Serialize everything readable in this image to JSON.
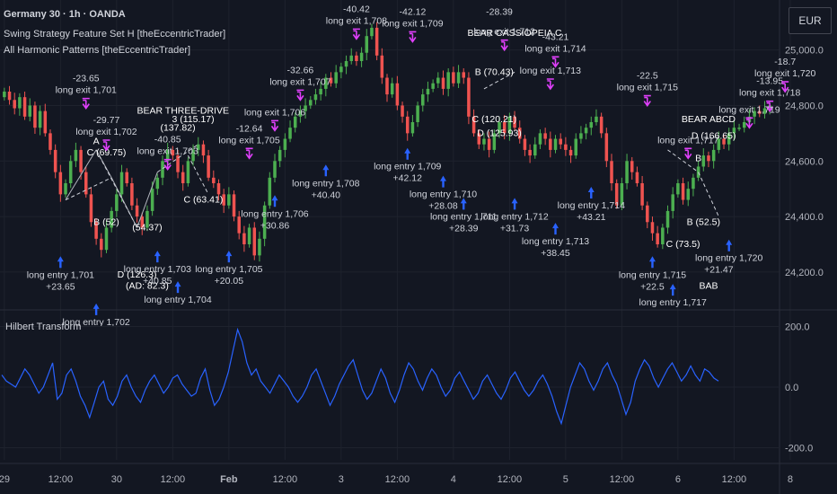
{
  "header": {
    "symbol": "Germany 30 · 1h · OANDA",
    "indicator1": "Swing Strategy Feature Set H [theEccentricTrader]",
    "indicator2": "All Harmonic Patterns [theEccentricTrader]"
  },
  "currency_button": "EUR",
  "oscillator": {
    "title": "Hilbert Transform"
  },
  "colors": {
    "background": "#131722",
    "grid": "#1e222d",
    "bull_candle": "#4caf50",
    "bear_candle": "#ef5350",
    "entry_arrow": "#2962ff",
    "exit_arrow": "#e040fb",
    "hilbert_line": "#2962ff",
    "text": "#d1d4dc",
    "axis_text": "#b2b5be"
  },
  "chart_data": [
    {
      "type": "candlestick",
      "ylim": [
        24080,
        25180
      ],
      "price_ticks": [
        24200,
        24400,
        24600,
        24800,
        25000
      ],
      "price_tick_labels": [
        "24,200.0",
        "24,400.0",
        "24,600.0",
        "24,800.0",
        "25,000.0"
      ],
      "time_ticks": [
        {
          "index": 0,
          "label": "29"
        },
        {
          "index": 11,
          "label": "12:00"
        },
        {
          "index": 22,
          "label": "30"
        },
        {
          "index": 33,
          "label": "12:00"
        },
        {
          "index": 44,
          "label": "Feb",
          "bold": true
        },
        {
          "index": 55,
          "label": "12:00"
        },
        {
          "index": 66,
          "label": "3"
        },
        {
          "index": 77,
          "label": "12:00"
        },
        {
          "index": 88,
          "label": "4"
        },
        {
          "index": 99,
          "label": "12:00"
        },
        {
          "index": 110,
          "label": "5"
        },
        {
          "index": 121,
          "label": "12:00"
        },
        {
          "index": 132,
          "label": "6"
        },
        {
          "index": 143,
          "label": "12:00"
        },
        {
          "index": 154,
          "label": "8"
        }
      ],
      "closes": [
        24850,
        24820,
        24790,
        24830,
        24760,
        24800,
        24720,
        24780,
        24700,
        24640,
        24560,
        24480,
        24520,
        24600,
        24640,
        24560,
        24480,
        24380,
        24320,
        24280,
        24360,
        24420,
        24480,
        24560,
        24520,
        24440,
        24400,
        24360,
        24420,
        24500,
        24540,
        24600,
        24640,
        24620,
        24560,
        24520,
        24600,
        24640,
        24660,
        24620,
        24540,
        24520,
        24480,
        24440,
        24480,
        24400,
        24340,
        24300,
        24360,
        24260,
        24320,
        24440,
        24540,
        24600,
        24640,
        24680,
        24720,
        24760,
        24780,
        24800,
        24820,
        24840,
        24860,
        24900,
        24880,
        24920,
        24940,
        24960,
        24980,
        24960,
        24990,
        25050,
        25080,
        24980,
        24900,
        24840,
        24880,
        24800,
        24760,
        24700,
        24740,
        24800,
        24840,
        24860,
        24880,
        24900,
        24860,
        24920,
        24880,
        24920,
        24900,
        24760,
        24700,
        24660,
        24680,
        24640,
        24700,
        24740,
        24700,
        24760,
        24720,
        24680,
        24640,
        24620,
        24660,
        24700,
        24680,
        24640,
        24680,
        24660,
        24640,
        24620,
        24680,
        24700,
        24720,
        24740,
        24760,
        24700,
        24600,
        24520,
        24440,
        24520,
        24600,
        24560,
        24520,
        24440,
        24380,
        24340,
        24300,
        24360,
        24420,
        24480,
        24520,
        24460,
        24500,
        24540,
        24580,
        24620,
        24600,
        24640,
        24680,
        24660,
        24700,
        24720,
        24720,
        24740,
        24760,
        24780,
        24770,
        24790,
        24800
      ],
      "series_hilbert": [
        40,
        20,
        10,
        0,
        30,
        60,
        40,
        10,
        -20,
        0,
        40,
        80,
        -40,
        -20,
        40,
        60,
        20,
        -30,
        -60,
        -100,
        -50,
        0,
        20,
        -40,
        -60,
        -30,
        20,
        40,
        0,
        -30,
        -50,
        -10,
        20,
        40,
        10,
        -20,
        0,
        30,
        40,
        10,
        -10,
        -30,
        -20,
        30,
        60,
        -10,
        -60,
        -40,
        0,
        50,
        120,
        190,
        150,
        80,
        40,
        60,
        20,
        0,
        -20,
        10,
        40,
        20,
        0,
        -30,
        -50,
        -30,
        0,
        40,
        60,
        20,
        -20,
        -60,
        -30,
        10,
        40,
        70,
        90,
        40,
        -10,
        -40,
        -20,
        20,
        60,
        30,
        -20,
        -50,
        -10,
        40,
        80,
        60,
        20,
        -10,
        30,
        60,
        40,
        0,
        -30,
        -10,
        30,
        50,
        20,
        -10,
        -40,
        -20,
        20,
        40,
        10,
        -20,
        -40,
        -10,
        30,
        50,
        20,
        -10,
        -30,
        -10,
        20,
        40,
        10,
        -30,
        -80,
        -120,
        -60,
        0,
        40,
        80,
        60,
        20,
        -10,
        20,
        60,
        80,
        40,
        10,
        -40,
        -90,
        -50,
        20,
        60,
        90,
        70,
        30,
        0,
        30,
        60,
        80,
        50,
        20,
        40,
        70,
        40,
        20,
        60,
        50,
        30,
        20
      ],
      "hilbert_ylim": [
        -240,
        240
      ],
      "hilbert_ticks": [
        200,
        0,
        -200
      ],
      "hilbert_tick_labels": [
        "200.0",
        "0.0",
        "-200.0"
      ],
      "signals": [
        {
          "kind": "entry",
          "index": 11,
          "price": 24270,
          "text": "long entry 1,701"
        },
        {
          "kind": "entry_pnl",
          "index": 11,
          "price": 24270,
          "text": "+23.65"
        },
        {
          "kind": "exit",
          "index": 16,
          "price": 24780,
          "text": "long exit 1,701"
        },
        {
          "kind": "exit_pnl",
          "index": 16,
          "price": 24780,
          "text": "-23.65"
        },
        {
          "kind": "exit",
          "index": 20,
          "price": 24630,
          "text": "long exit 1,702"
        },
        {
          "kind": "exit_pnl",
          "index": 20,
          "price": 24630,
          "text": "-29.77"
        },
        {
          "kind": "entry",
          "index": 18,
          "price": 24100,
          "text": "long entry 1,702"
        },
        {
          "kind": "exit",
          "index": 32,
          "price": 24560,
          "text": "long exit 1,703"
        },
        {
          "kind": "exit_pnl",
          "index": 32,
          "price": 24560,
          "text": "-40.85"
        },
        {
          "kind": "entry",
          "index": 34,
          "price": 24180,
          "text": "long entry 1,704"
        },
        {
          "kind": "entry",
          "index": 30,
          "price": 24290,
          "text": "long entry 1,703"
        },
        {
          "kind": "entry_pnl",
          "index": 30,
          "price": 24290,
          "text": "+40.85"
        },
        {
          "kind": "entry",
          "index": 44,
          "price": 24290,
          "text": "long entry 1,705"
        },
        {
          "kind": "entry_pnl",
          "index": 44,
          "price": 24290,
          "text": "+20.05"
        },
        {
          "kind": "exit",
          "index": 48,
          "price": 24600,
          "text": "long exit 1,705"
        },
        {
          "kind": "exit_pnl",
          "index": 48,
          "price": 24600,
          "text": "-12.64"
        },
        {
          "kind": "entry",
          "index": 53,
          "price": 24490,
          "text": "long entry 1,706"
        },
        {
          "kind": "entry_pnl",
          "index": 53,
          "price": 24490,
          "text": "+30.86"
        },
        {
          "kind": "exit",
          "index": 53,
          "price": 24700,
          "text": "long exit 1,706"
        },
        {
          "kind": "exit",
          "index": 58,
          "price": 24810,
          "text": "long exit 1,707"
        },
        {
          "kind": "exit_pnl",
          "index": 58,
          "price": 24810,
          "text": "-32.66"
        },
        {
          "kind": "entry",
          "index": 63,
          "price": 24600,
          "text": "long entry 1,708"
        },
        {
          "kind": "entry_pnl",
          "index": 63,
          "price": 24600,
          "text": "+40.40"
        },
        {
          "kind": "exit",
          "index": 69,
          "price": 25030,
          "text": "long exit 1,708"
        },
        {
          "kind": "exit_pnl",
          "index": 69,
          "price": 25030,
          "text": "-40.42"
        },
        {
          "kind": "exit",
          "index": 80,
          "price": 25020,
          "text": "long exit 1,709"
        },
        {
          "kind": "exit_pnl",
          "index": 80,
          "price": 25020,
          "text": "-42.12"
        },
        {
          "kind": "entry",
          "index": 79,
          "price": 24660,
          "text": "long entry 1,709"
        },
        {
          "kind": "entry_pnl",
          "index": 79,
          "price": 24660,
          "text": "+42.12"
        },
        {
          "kind": "entry",
          "index": 86,
          "price": 24560,
          "text": "long entry 1,710"
        },
        {
          "kind": "entry_pnl",
          "index": 86,
          "price": 24560,
          "text": "+28.08"
        },
        {
          "kind": "entry",
          "index": 90,
          "price": 24480,
          "text": "long entry 1,711"
        },
        {
          "kind": "entry_pnl",
          "index": 90,
          "price": 24480,
          "text": "+28.39"
        },
        {
          "kind": "entry",
          "index": 100,
          "price": 24480,
          "text": "long entry 1,712"
        },
        {
          "kind": "entry_pnl",
          "index": 100,
          "price": 24480,
          "text": "+31.73"
        },
        {
          "kind": "entry",
          "index": 108,
          "price": 24390,
          "text": "long entry 1,713"
        },
        {
          "kind": "entry_pnl",
          "index": 108,
          "price": 24390,
          "text": "+38.45"
        },
        {
          "kind": "entry",
          "index": 115,
          "price": 24520,
          "text": "long entry 1,714"
        },
        {
          "kind": "entry_pnl",
          "index": 115,
          "price": 24520,
          "text": "+43.21"
        },
        {
          "kind": "exit",
          "index": 98,
          "price": 24990,
          "text": "long exit 1,712"
        },
        {
          "kind": "exit",
          "index": 108,
          "price": 24930,
          "text": "long exit 1,714"
        },
        {
          "kind": "exit_pnl",
          "index": 108,
          "price": 24930,
          "text": "-43.21"
        },
        {
          "kind": "exit",
          "index": 107,
          "price": 24850,
          "text": "long exit 1,713"
        },
        {
          "kind": "exit_pnl",
          "index": 97,
          "price": 25020,
          "text": "-28.39"
        },
        {
          "kind": "exit",
          "index": 126,
          "price": 24790,
          "text": "long exit 1,715"
        },
        {
          "kind": "exit_pnl",
          "index": 126,
          "price": 24790,
          "text": "-22.5"
        },
        {
          "kind": "entry",
          "index": 127,
          "price": 24270,
          "text": "long entry 1,715"
        },
        {
          "kind": "entry_pnl",
          "index": 127,
          "price": 24270,
          "text": "+22.5"
        },
        {
          "kind": "entry",
          "index": 131,
          "price": 24170,
          "text": "long entry 1,717"
        },
        {
          "kind": "exit",
          "index": 134,
          "price": 24600,
          "text": "long exit 1,717"
        },
        {
          "kind": "entry",
          "index": 142,
          "price": 24330,
          "text": "long entry 1,720"
        },
        {
          "kind": "entry_pnl",
          "index": 140,
          "price": 24330,
          "text": "+21.47"
        },
        {
          "kind": "exit",
          "index": 150,
          "price": 24770,
          "text": "long exit 1,718"
        },
        {
          "kind": "exit_pnl",
          "index": 150,
          "price": 24770,
          "text": "-13.95"
        },
        {
          "kind": "exit",
          "index": 146,
          "price": 24710,
          "text": "long exit 1,719"
        },
        {
          "kind": "exit",
          "index": 153,
          "price": 24840,
          "text": "long exit 1,720"
        },
        {
          "kind": "exit_pnl",
          "index": 153,
          "price": 24840,
          "text": "-18.7"
        }
      ],
      "pattern_labels": [
        {
          "index": 18,
          "price": 24660,
          "text": "A"
        },
        {
          "index": 20,
          "price": 24620,
          "text": "C (69.75)"
        },
        {
          "index": 20,
          "price": 24370,
          "text": "B (52)"
        },
        {
          "index": 28,
          "price": 24350,
          "text": "(54.37)"
        },
        {
          "index": 26,
          "price": 24180,
          "text": "D (126.3)"
        },
        {
          "index": 28,
          "price": 24140,
          "text": "(AD: 82.3)"
        },
        {
          "index": 35,
          "price": 24770,
          "text": "BEAR THREE-DRIVE"
        },
        {
          "index": 37,
          "price": 24740,
          "text": "3 (115.17)"
        },
        {
          "index": 34,
          "price": 24710,
          "text": "(137.82)"
        },
        {
          "index": 39,
          "price": 24450,
          "text": "C (63.41)"
        },
        {
          "index": 100,
          "price": 25050,
          "text": "BEAR CASSIOPEIA C"
        },
        {
          "index": 96,
          "price": 24910,
          "text": "B (70.43)"
        },
        {
          "index": 96,
          "price": 24740,
          "text": "C (120.21)"
        },
        {
          "index": 97,
          "price": 24690,
          "text": "D (125.93)"
        },
        {
          "index": 138,
          "price": 24740,
          "text": "BEAR ABCD"
        },
        {
          "index": 139,
          "price": 24680,
          "text": "D (166.65)"
        },
        {
          "index": 136,
          "price": 24600,
          "text": "B"
        },
        {
          "index": 137,
          "price": 24370,
          "text": "B (52.5)"
        },
        {
          "index": 133,
          "price": 24290,
          "text": "C (73.5)"
        },
        {
          "index": 138,
          "price": 24140,
          "text": "BAB"
        }
      ],
      "pattern_lines": [
        {
          "from": [
            12,
            24460
          ],
          "to": [
            18,
            24640
          ],
          "style": "solid",
          "color": "#b2b5be"
        },
        {
          "from": [
            18,
            24640
          ],
          "to": [
            21,
            24540
          ],
          "style": "solid",
          "color": "#b2b5be"
        },
        {
          "from": [
            21,
            24540
          ],
          "to": [
            26,
            24360
          ],
          "style": "solid",
          "color": "#b2b5be"
        },
        {
          "from": [
            26,
            24360
          ],
          "to": [
            30,
            24560
          ],
          "style": "solid",
          "color": "#b2b5be"
        },
        {
          "from": [
            12,
            24460
          ],
          "to": [
            21,
            24540
          ],
          "style": "dashed",
          "color": "#d1d4dc"
        },
        {
          "from": [
            18,
            24640
          ],
          "to": [
            26,
            24360
          ],
          "style": "dashed",
          "color": "#d1d4dc"
        },
        {
          "from": [
            30,
            24560
          ],
          "to": [
            38,
            24660
          ],
          "style": "dashed",
          "color": "#d1d4dc"
        },
        {
          "from": [
            36,
            24620
          ],
          "to": [
            40,
            24480
          ],
          "style": "dashed",
          "color": "#d1d4dc"
        },
        {
          "from": [
            94,
            24860
          ],
          "to": [
            100,
            24920
          ],
          "style": "dashed",
          "color": "#d1d4dc"
        },
        {
          "from": [
            130,
            24640
          ],
          "to": [
            136,
            24560
          ],
          "style": "dashed",
          "color": "#d1d4dc"
        },
        {
          "from": [
            136,
            24560
          ],
          "to": [
            140,
            24400
          ],
          "style": "dashed",
          "color": "#d1d4dc"
        }
      ]
    }
  ]
}
